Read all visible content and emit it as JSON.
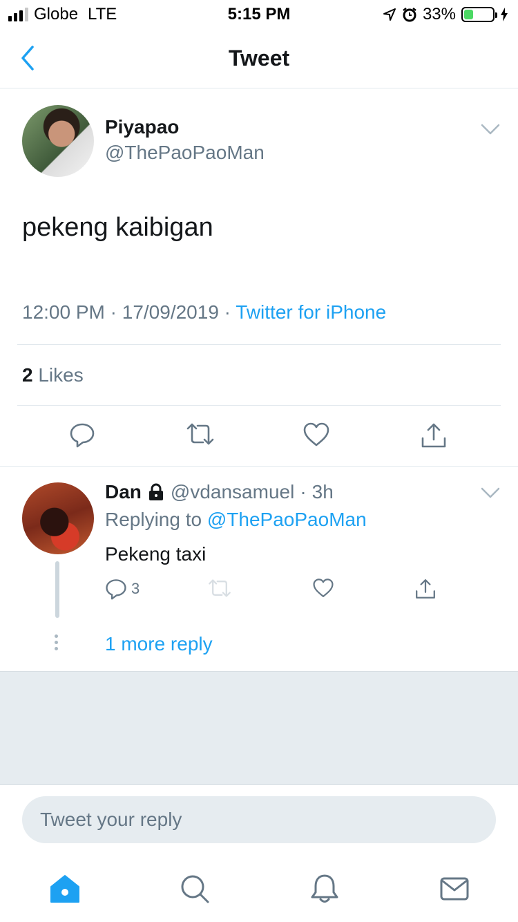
{
  "status_bar": {
    "carrier": "Globe",
    "network": "LTE",
    "time": "5:15 PM",
    "battery_percent": "33%",
    "battery_level": 0.33,
    "icons": [
      "signal-bars-icon",
      "location-arrow-icon",
      "alarm-clock-icon",
      "battery-icon",
      "charging-bolt-icon"
    ]
  },
  "nav": {
    "title": "Tweet",
    "back_icon": "chevron-left-icon"
  },
  "tweet": {
    "author_name": "Piyapao",
    "author_handle": "@ThePaoPaoMan",
    "text": "pekeng kaibigan",
    "time": "12:00 PM",
    "date": "17/09/2019",
    "source": "Twitter for iPhone",
    "separator": "·",
    "likes_count": "2",
    "likes_label": "Likes",
    "actions": [
      "reply-icon",
      "retweet-icon",
      "like-icon",
      "share-icon"
    ]
  },
  "reply": {
    "author_name": "Dan",
    "author_handle": "@vdansamuel",
    "separator": "·",
    "age": "3h",
    "protected_icon": "lock-icon",
    "replying_prefix": "Replying to",
    "replying_to": "@ThePaoPaoMan",
    "text": "Pekeng taxi",
    "reply_count": "3",
    "more_replies": "1 more reply"
  },
  "composer": {
    "placeholder": "Tweet your reply"
  },
  "tabbar": {
    "tabs": [
      "home-icon",
      "search-icon",
      "notifications-icon",
      "messages-icon"
    ],
    "active": "home-icon"
  },
  "colors": {
    "accent": "#1da1f2",
    "secondary_text": "#657786",
    "divider": "#e1e8ed",
    "gray_background": "#e6ecf0",
    "battery_green": "#4cd964"
  }
}
